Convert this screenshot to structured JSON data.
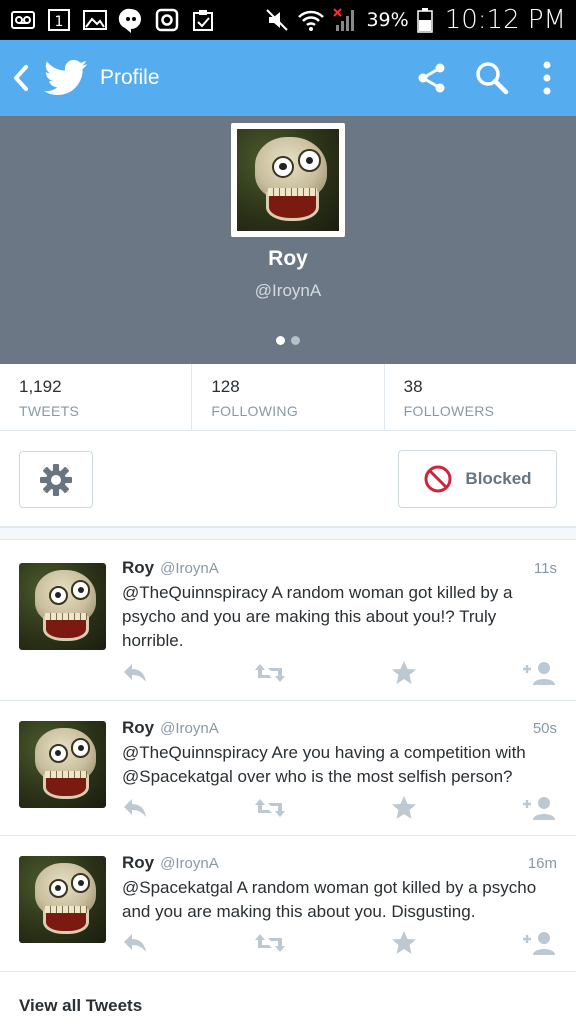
{
  "status_bar": {
    "battery_percent": "39%",
    "time": "10:12 PM"
  },
  "app_bar": {
    "title": "Profile"
  },
  "profile": {
    "name": "Roy",
    "handle": "@IroynA"
  },
  "stats": [
    {
      "value": "1,192",
      "label": "TWEETS"
    },
    {
      "value": "128",
      "label": "FOLLOWING"
    },
    {
      "value": "38",
      "label": "FOLLOWERS"
    }
  ],
  "actions": {
    "blocked_label": "Blocked"
  },
  "tweets": [
    {
      "name": "Roy",
      "handle": "@IroynA",
      "time": "11s",
      "text": "@TheQuinnspiracy A random woman got killed by a psycho and you are making this about you!? Truly horrible."
    },
    {
      "name": "Roy",
      "handle": "@IroynA",
      "time": "50s",
      "text": "@TheQuinnspiracy Are you having a competition with @Spacekatgal over who is the most selfish person?"
    },
    {
      "name": "Roy",
      "handle": "@IroynA",
      "time": "16m",
      "text": "@Spacekatgal A random woman got killed by a psycho and you are making this about you. Disgusting."
    }
  ],
  "footer": {
    "view_all_label": "View all Tweets"
  },
  "colors": {
    "brand": "#55acee",
    "header_bg": "#6b7785",
    "blocked_red": "#d0243a"
  }
}
